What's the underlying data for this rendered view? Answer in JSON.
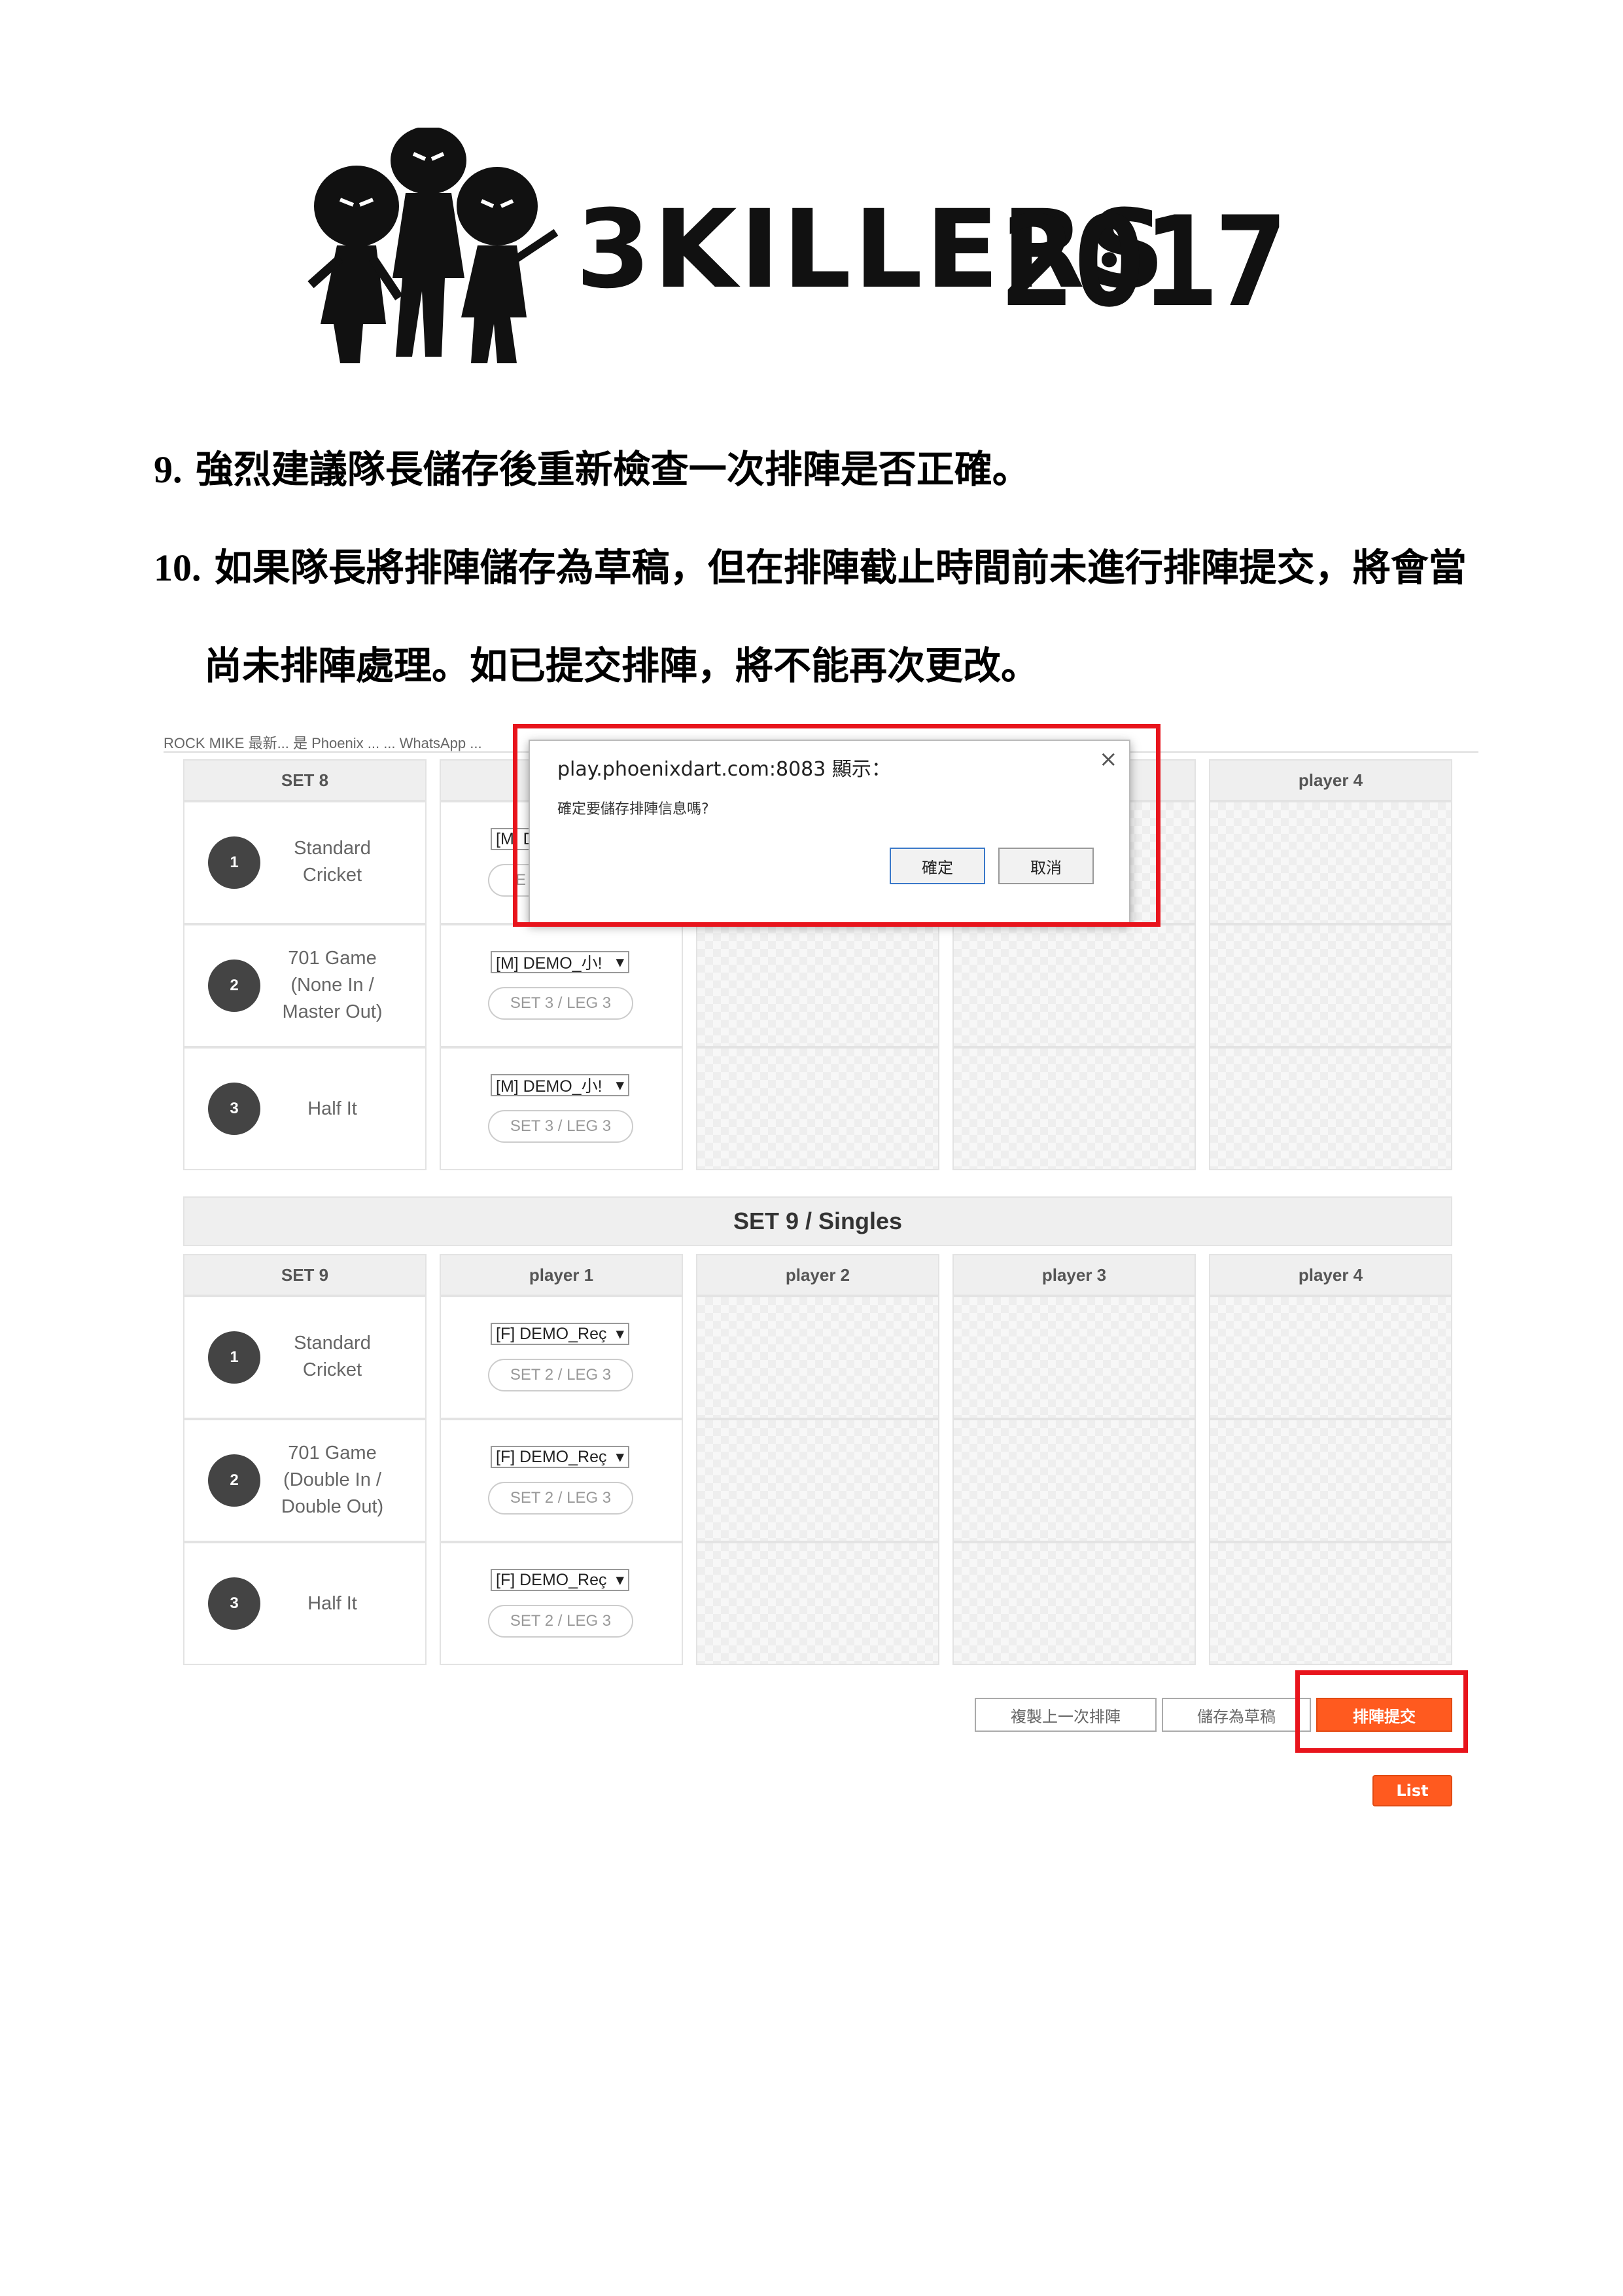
{
  "logo": {
    "text": "3KILLERS",
    "year": "2017"
  },
  "instructions": [
    {
      "num": "9.",
      "text": "強烈建議隊長儲存後重新檢查一次排陣是否正確。"
    },
    {
      "num": "10.",
      "text": "如果隊長將排陣儲存為草稿，但在排陣截止時間前未進行排陣提交，將會當"
    },
    {
      "num": "",
      "text": "尚未排陣處理。如已提交排陣，將不能再次更改。"
    }
  ],
  "browser_bar": "ROCK MIKE 最新... 是 Phoenix ...  ... WhatsApp  ...",
  "dialog": {
    "origin": "play.phoenixdart.com:8083 顯示：",
    "message": "確定要儲存排陣信息嗎?",
    "ok": "確定",
    "cancel": "取消",
    "close": "×"
  },
  "set8": {
    "header_set": "SET 8",
    "header_p4": "player 4",
    "rows": [
      {
        "n": "1",
        "game": "Standard\nCricket",
        "player": "[M] D",
        "leg": "E"
      },
      {
        "n": "2",
        "game": "701 Game\n(None In /\nMaster Out)",
        "player": "[M] DEMO_小!",
        "leg": "SET 3 / LEG 3"
      },
      {
        "n": "3",
        "game": "Half It",
        "player": "[M] DEMO_小!",
        "leg": "SET 3 / LEG 3"
      }
    ]
  },
  "set9": {
    "title": "SET 9 / Singles",
    "headers": [
      "SET 9",
      "player 1",
      "player 2",
      "player 3",
      "player 4"
    ],
    "rows": [
      {
        "n": "1",
        "game": "Standard\nCricket",
        "player": "[F] DEMO_Reç",
        "leg": "SET 2 / LEG 3"
      },
      {
        "n": "2",
        "game": "701 Game\n(Double In /\nDouble Out)",
        "player": "[F] DEMO_Reç",
        "leg": "SET 2 / LEG 3"
      },
      {
        "n": "3",
        "game": "Half It",
        "player": "[F] DEMO_Reç",
        "leg": "SET 2 / LEG 3"
      }
    ]
  },
  "actions": {
    "copy": "複製上一次排陣",
    "draft": "儲存為草稿",
    "submit": "排陣提交",
    "list": "List"
  },
  "colors": {
    "accent": "#ff5a1f",
    "highlight": "#e8141c"
  }
}
